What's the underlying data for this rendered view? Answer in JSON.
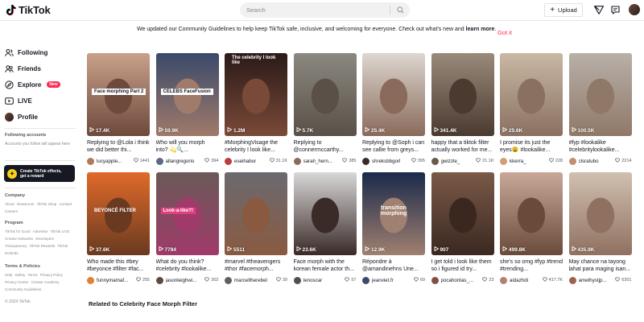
{
  "header": {
    "logo_text": "TikTok",
    "search_placeholder": "Search",
    "upload_label": "Upload"
  },
  "notice": {
    "text": "We updated our Community Guidelines to help keep TikTok safe, inclusive, and welcoming for everyone. Check out what's new and ",
    "bold": "learn more",
    "tail": ".",
    "button": "Got it"
  },
  "sidebar": {
    "nav": [
      {
        "label": "Following",
        "icon": "users-icon"
      },
      {
        "label": "Friends",
        "icon": "friends-icon"
      },
      {
        "label": "Explore",
        "icon": "compass-icon",
        "badge": "New"
      },
      {
        "label": "LIVE",
        "icon": "live-icon"
      },
      {
        "label": "Profile",
        "icon": "avatar"
      }
    ],
    "following_head": "Following accounts",
    "following_sub": "Accounts you follow will appear here",
    "effects_line1": "Create TikTok effects,",
    "effects_line2": "get a reward",
    "footer": [
      {
        "head": "Company",
        "links": [
          "About",
          "Newsroom",
          "TikTok Shop",
          "Contact",
          "Careers"
        ]
      },
      {
        "head": "Program",
        "links": [
          "TikTok for Good",
          "Advertise",
          "TikTok LIVE Creator Networks",
          "Developers",
          "Transparency",
          "TikTok Rewards",
          "TikTok Embeds"
        ]
      },
      {
        "head": "Terms & Policies",
        "links": [
          "Help",
          "Safety",
          "Terms",
          "Privacy Policy",
          "Privacy Center",
          "Creator Academy",
          "Community Guidelines"
        ]
      }
    ],
    "copyright": "© 2024 TikTok"
  },
  "videos": [
    {
      "views": "17.4K",
      "caption": "Replying to @Lola i think we did better thi...",
      "user": "lucyapple...",
      "likes": "1441",
      "overlay": "Face morphing Part 2",
      "bg": "#c9a08a",
      "bg2": "#6e4a3c",
      "av": "#b07a5a"
    },
    {
      "views": "59.9K",
      "caption": "Who will you morph into? 💫🔍...",
      "user": "allangregorio",
      "likes": "394",
      "overlay": "CELEBS FaceFusion",
      "bg": "#3a4a6a",
      "bg2": "#a07a6a",
      "av": "#5a6a8a"
    },
    {
      "views": "1.2M",
      "caption": "#MorphingVisage the celebrity I look like...",
      "user": "eseihabor",
      "likes": "31.1K",
      "overlay": "The celebrity I look like",
      "bg": "#2a1a18",
      "bg2": "#7a4a38",
      "av": "#c03a3a"
    },
    {
      "views": "5.7K",
      "caption": "Replying to @connermccarthy...",
      "user": "sarah_hern...",
      "likes": "385",
      "overlay": "",
      "bg": "#8a8880",
      "bg2": "#5a5048",
      "av": "#8a6a5a"
    },
    {
      "views": "25.4K",
      "caption": "Replying to @Soph i can see callie from greys...",
      "user": "shreksbbgorl",
      "likes": "395",
      "overlay": "",
      "bg": "#ddd6d0",
      "bg2": "#8a6a5a",
      "av": "#3a2a2a"
    },
    {
      "views": "341.4K",
      "caption": "happy that a tiktok filter actually worked for me...",
      "user": "gwizzle_",
      "likes": "21.1K",
      "overlay": "",
      "bg": "#9a8a7a",
      "bg2": "#4a3a30",
      "av": "#6a5a4a"
    },
    {
      "views": "25.6K",
      "caption": "I promise its just the eyes😩 #lookalike...",
      "user": "kkerra_",
      "likes": "228",
      "overlay": "",
      "bg": "#c8b8a4",
      "bg2": "#8a7060",
      "av": "#d0a070"
    },
    {
      "views": "100.5K",
      "caption": "#fyp #lookalike #celebritylookalike...",
      "user": "clsratubo",
      "likes": "2214",
      "overlay": "",
      "bg": "#b8b0a8",
      "bg2": "#907868",
      "av": "#c09070"
    },
    {
      "views": "37.6K",
      "caption": "Who made this #bey #beyonce #filter #fac...",
      "user": "funnymamaf...",
      "likes": "255",
      "overlay": "BEYONCÉ FILTER",
      "bg": "#e06a2a",
      "bg2": "#6a3a20",
      "av": "#e08030"
    },
    {
      "views": "7784",
      "caption": "What do you think? #celebrity #lookalike...",
      "user": "jasonleighwi...",
      "likes": "302",
      "overlay": "Look-a-like?!",
      "bg": "#6a5a58",
      "bg2": "#a03a6a",
      "av": "#5a4a40"
    },
    {
      "views": "5511",
      "caption": "#marvel #theavengers #thor #facemorph...",
      "user": "marceltherebel",
      "likes": "39",
      "overlay": "",
      "bg": "#6a6a70",
      "bg2": "#8a5a40",
      "av": "#606060"
    },
    {
      "views": "23.6K",
      "caption": "Face morph with the korean female actor th...",
      "user": "tenoscar",
      "likes": "57",
      "overlay": "",
      "bg": "#d8d8d8",
      "bg2": "#3a2a28",
      "av": "#505050"
    },
    {
      "views": "12.9K",
      "caption": "Répondre à @amandinehns Une...",
      "user": "jeanviet.fr",
      "likes": "69",
      "overlay": "transition morphing",
      "bg": "#1a2a4a",
      "bg2": "#a08070",
      "av": "#3a4a6a"
    },
    {
      "views": "907",
      "caption": "I get told i look like them so i figured id try...",
      "user": "pocahontas_...",
      "likes": "23",
      "overlay": "",
      "bg": "#7a5a48",
      "bg2": "#3a2820",
      "av": "#805040"
    },
    {
      "views": "499.8K",
      "caption": "she's so omg #fyp #trend #trending...",
      "user": "aidazhdi",
      "likes": "417.7K",
      "overlay": "",
      "bg": "#c8a898",
      "bg2": "#6a4a3a",
      "av": "#b08070"
    },
    {
      "views": "435.9K",
      "caption": "May chance na tayong lahat para maging isan...",
      "user": "amethystjp...",
      "likes": "6301",
      "overlay": "",
      "bg": "#d0c0b0",
      "bg2": "#907060",
      "av": "#a06050"
    }
  ],
  "related_heading": "Related to Celebrity Face Morph Filter",
  "colors": {
    "accent": "#fe2c55",
    "text": "#161823",
    "muted": "#8a8b91"
  }
}
